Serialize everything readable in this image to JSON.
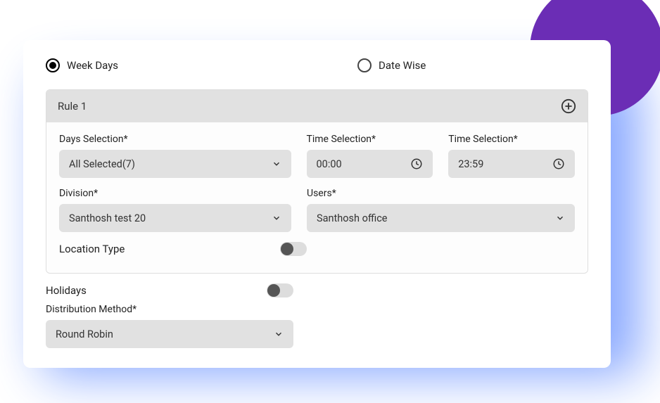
{
  "radio": {
    "week_days": "Week Days",
    "date_wise": "Date Wise"
  },
  "rule": {
    "title": "Rule 1",
    "days_label": "Days Selection*",
    "days_value": "All Selected(7)",
    "time_start_label": "Time Selection*",
    "time_start_value": "00:00",
    "time_end_label": "Time Selection*",
    "time_end_value": "23:59",
    "division_label": "Division*",
    "division_value": "Santhosh test 20",
    "users_label": "Users*",
    "users_value": "Santhosh office",
    "location_type_label": "Location Type"
  },
  "holidays_label": "Holidays",
  "distribution_label": "Distribution Method*",
  "distribution_value": "Round Robin"
}
